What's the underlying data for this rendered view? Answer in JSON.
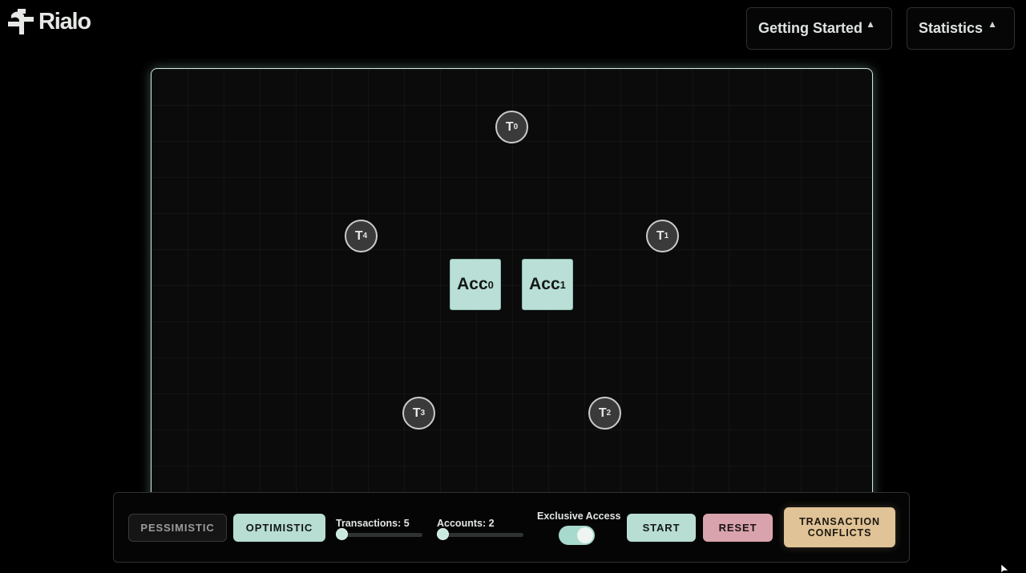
{
  "brand": {
    "name": "Rialo"
  },
  "header": {
    "getting_started": {
      "label": "Getting Started",
      "caret": "▲"
    },
    "statistics": {
      "label": "Statistics",
      "caret": "▲"
    }
  },
  "canvas": {
    "transactions": [
      {
        "letter": "T",
        "sub": "0"
      },
      {
        "letter": "T",
        "sub": "1"
      },
      {
        "letter": "T",
        "sub": "2"
      },
      {
        "letter": "T",
        "sub": "3"
      },
      {
        "letter": "T",
        "sub": "4"
      }
    ],
    "accounts": [
      {
        "letter": "Acc",
        "sub": "0"
      },
      {
        "letter": "Acc",
        "sub": "1"
      }
    ]
  },
  "controls": {
    "pessimistic": "PESSIMISTIC",
    "optimistic": "OPTIMISTIC",
    "transactions_label": "Transactions: 5",
    "accounts_label": "Accounts: 2",
    "exclusive_access_label": "Exclusive Access",
    "exclusive_access_on": true,
    "start": "START",
    "reset": "RESET",
    "conflicts_line1": "TRANSACTION",
    "conflicts_line2": "CONFLICTS"
  },
  "colors": {
    "accent_mint": "#b8ddd3",
    "reset_pink": "#d9a3ad",
    "conflicts_gold": "#e0c396"
  },
  "icons": {
    "logo": "rialo-logo-icon",
    "cursor": "mouse-cursor-icon"
  }
}
